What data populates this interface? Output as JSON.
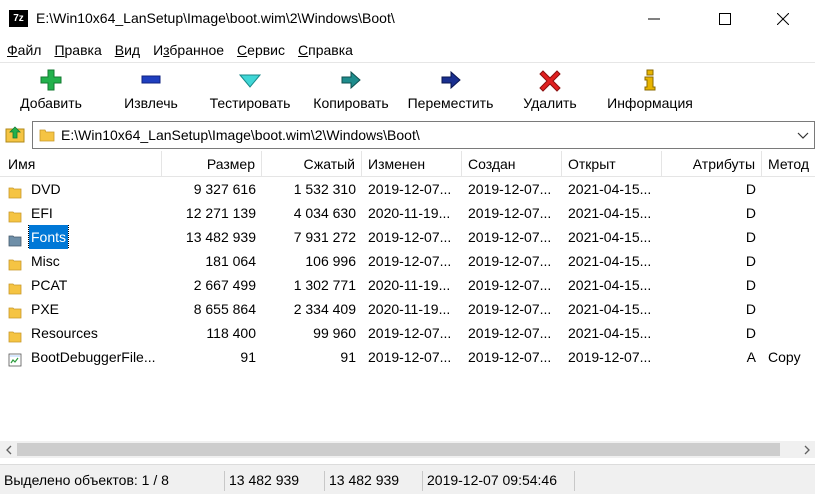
{
  "window": {
    "app_icon_text": "7z",
    "title": "E:\\Win10x64_LanSetup\\Image\\boot.wim\\2\\Windows\\Boot\\"
  },
  "menu": [
    {
      "pre": "",
      "u": "Ф",
      "post": "айл"
    },
    {
      "pre": "",
      "u": "П",
      "post": "равка"
    },
    {
      "pre": "",
      "u": "В",
      "post": "ид"
    },
    {
      "pre": "И",
      "u": "з",
      "post": "бранное"
    },
    {
      "pre": "",
      "u": "С",
      "post": "ервис"
    },
    {
      "pre": "",
      "u": "С",
      "post": "правка"
    }
  ],
  "toolbar": {
    "add": "Добавить",
    "extract": "Извлечь",
    "test": "Тестировать",
    "copy": "Копировать",
    "move": "Переместить",
    "delete": "Удалить",
    "info": "Информация",
    "colors": {
      "add": "#22b14c",
      "extract": "#1f3fbf",
      "test": "#3fd6d6",
      "copy": "#1e8c8c",
      "move": "#1a2f8f",
      "delete": "#e02020",
      "info": "#e8b400"
    }
  },
  "address": {
    "path": "E:\\Win10x64_LanSetup\\Image\\boot.wim\\2\\Windows\\Boot\\"
  },
  "columns": {
    "name": "Имя",
    "size": "Размер",
    "packed": "Сжатый",
    "modified": "Изменен",
    "created": "Создан",
    "accessed": "Открыт",
    "attributes": "Атрибуты",
    "method": "Метод"
  },
  "files": [
    {
      "name": "DVD",
      "icon": "folder-icon",
      "size": "9 327 616",
      "packed": "1 532 310",
      "modified": "2019-12-07...",
      "created": "2019-12-07...",
      "accessed": "2021-04-15...",
      "attr": "D",
      "method": "",
      "selected": false
    },
    {
      "name": "EFI",
      "icon": "folder-icon",
      "size": "12 271 139",
      "packed": "4 034 630",
      "modified": "2020-11-19...",
      "created": "2019-12-07...",
      "accessed": "2021-04-15...",
      "attr": "D",
      "method": "",
      "selected": false
    },
    {
      "name": "Fonts",
      "icon": "fonts-folder-icon",
      "size": "13 482 939",
      "packed": "7 931 272",
      "modified": "2019-12-07...",
      "created": "2019-12-07...",
      "accessed": "2021-04-15...",
      "attr": "D",
      "method": "",
      "selected": true
    },
    {
      "name": "Misc",
      "icon": "folder-icon",
      "size": "181 064",
      "packed": "106 996",
      "modified": "2019-12-07...",
      "created": "2019-12-07...",
      "accessed": "2021-04-15...",
      "attr": "D",
      "method": "",
      "selected": false
    },
    {
      "name": "PCAT",
      "icon": "folder-icon",
      "size": "2 667 499",
      "packed": "1 302 771",
      "modified": "2020-11-19...",
      "created": "2019-12-07...",
      "accessed": "2021-04-15...",
      "attr": "D",
      "method": "",
      "selected": false
    },
    {
      "name": "PXE",
      "icon": "folder-icon",
      "size": "8 655 864",
      "packed": "2 334 409",
      "modified": "2020-11-19...",
      "created": "2019-12-07...",
      "accessed": "2021-04-15...",
      "attr": "D",
      "method": "",
      "selected": false
    },
    {
      "name": "Resources",
      "icon": "folder-icon",
      "size": "118 400",
      "packed": "99 960",
      "modified": "2019-12-07...",
      "created": "2019-12-07...",
      "accessed": "2021-04-15...",
      "attr": "D",
      "method": "",
      "selected": false
    },
    {
      "name": "BootDebuggerFile...",
      "icon": "file-icon",
      "size": "91",
      "packed": "91",
      "modified": "2019-12-07...",
      "created": "2019-12-07...",
      "accessed": "2019-12-07...",
      "attr": "A",
      "method": "Copy",
      "selected": false
    }
  ],
  "status": {
    "selected": "Выделено объектов: 1 / 8",
    "size": "13 482 939",
    "packed": "13 482 939",
    "date": "2019-12-07 09:54:46"
  },
  "colors": {
    "selection": "#0078d7",
    "folder": "#f5c443"
  }
}
